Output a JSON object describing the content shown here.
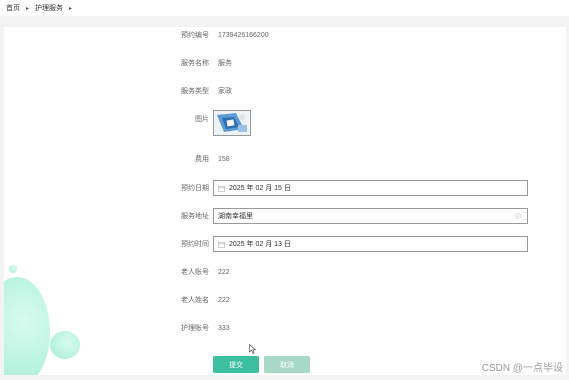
{
  "breadcrumb": {
    "home": "首页",
    "current": "护理服务"
  },
  "form": {
    "order_no": {
      "label": "预约编号",
      "value": "1739426166200"
    },
    "service_name": {
      "label": "服务名称",
      "value": "服务"
    },
    "service_type": {
      "label": "服务类型",
      "value": "家政"
    },
    "image": {
      "label": "图片"
    },
    "fee": {
      "label": "费用",
      "value": "158"
    },
    "order_date": {
      "label": "预约日期",
      "value": "2025 年 02 月 15 日"
    },
    "service_address": {
      "label": "服务地址",
      "value": "湖南幸福里"
    },
    "order_time": {
      "label": "预约时间",
      "value": "2025 年 02 月 13 日"
    },
    "elder_account": {
      "label": "老人账号",
      "value": "222"
    },
    "elder_name": {
      "label": "老人姓名",
      "value": "222"
    },
    "nurse_account": {
      "label": "护理账号",
      "value": "333"
    }
  },
  "buttons": {
    "submit": "提交",
    "cancel": "取消"
  },
  "watermark": "CSDN @一点毕设",
  "colors": {
    "primary": "#3bbf9e",
    "primary_disabled": "#a7d8c8",
    "decor": "#b9f3e0"
  }
}
